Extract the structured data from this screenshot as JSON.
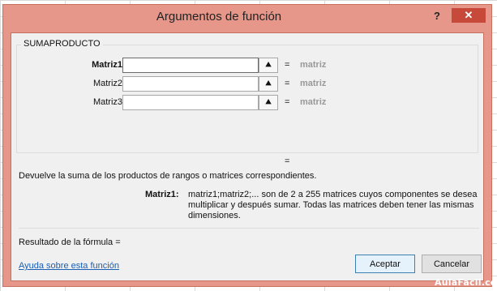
{
  "dialog": {
    "title": "Argumentos de función",
    "help_label": "?",
    "close_label": "✕"
  },
  "function": {
    "name": "SUMAPRODUCTO",
    "arguments": [
      {
        "label": "Matriz1",
        "value": "",
        "bold": true,
        "result": "matriz"
      },
      {
        "label": "Matriz2",
        "value": "",
        "bold": false,
        "result": "matriz"
      },
      {
        "label": "Matriz3",
        "value": "",
        "bold": false,
        "result": "matriz"
      }
    ],
    "collapse_icon": "⯅",
    "equals": "=",
    "result_equals": "=",
    "description": "Devuelve la suma de los productos de rangos o matrices correspondientes.",
    "arg_help_name": "Matriz1:",
    "arg_help_text": "matriz1;matriz2;... son de 2 a 255 matrices cuyos componentes se desea multiplicar y después sumar. Todas las matrices deben tener las mismas dimensiones."
  },
  "footer": {
    "formula_result": "Resultado de la fórmula =",
    "help_link": "Ayuda sobre esta función",
    "ok_label": "Aceptar",
    "cancel_label": "Cancelar"
  },
  "watermark": "AulaFacil.com",
  "colors": {
    "dialog_frame": "#e6978a",
    "close_button": "#c7493a",
    "link": "#1a5fb4"
  }
}
